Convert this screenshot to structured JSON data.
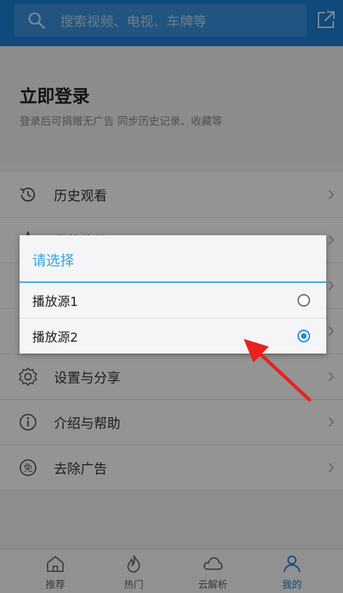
{
  "header": {
    "search_placeholder": "搜索视频、电视、车牌等",
    "icons": [
      "search-icon",
      "share-icon"
    ]
  },
  "login": {
    "title": "立即登录",
    "subtitle": "登录后可捐赠无广告 同步历史记录、收藏等"
  },
  "menu": {
    "items": [
      {
        "label": "历史观看",
        "icon": "history-icon"
      },
      {
        "label": "我的收藏",
        "icon": "favorites-icon"
      },
      {
        "label": "",
        "icon": "item-icon"
      },
      {
        "label": "",
        "icon": "item-icon"
      },
      {
        "label": "设置与分享",
        "icon": "gear-icon"
      },
      {
        "label": "介绍与帮助",
        "icon": "info-icon"
      },
      {
        "label": "去除广告",
        "icon": "no-ads-icon"
      }
    ]
  },
  "dialog": {
    "title": "请选择",
    "options": [
      {
        "label": "播放源1",
        "selected": false
      },
      {
        "label": "播放源2",
        "selected": true
      }
    ]
  },
  "bottom_nav": {
    "items": [
      {
        "label": "推荐",
        "icon": "home-icon",
        "active": false
      },
      {
        "label": "热门",
        "icon": "flame-icon",
        "active": false
      },
      {
        "label": "云解析",
        "icon": "cloud-icon",
        "active": false
      },
      {
        "label": "我的",
        "icon": "person-icon",
        "active": true
      }
    ]
  },
  "colors": {
    "header_bg": "#1c7fd4",
    "dialog_accent": "#33a6de",
    "radio_checked": "#1e88d8",
    "arrow_red": "#e8231f",
    "nav_active": "#1c7fd4"
  }
}
